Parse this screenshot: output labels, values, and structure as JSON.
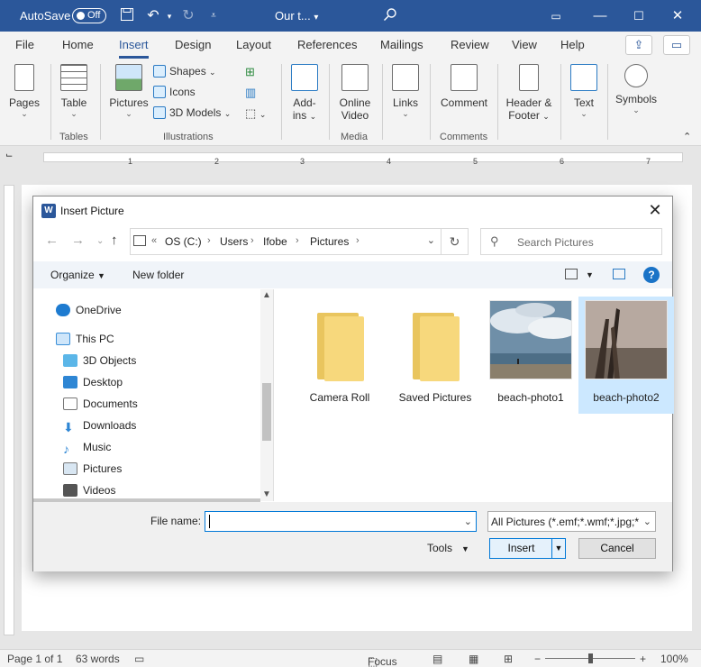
{
  "titlebar": {
    "autosave_label": "AutoSave",
    "autosave_state": "Off",
    "doc_title": "Our t...",
    "doc_title_chevron": "▾"
  },
  "menu": {
    "tabs": [
      "File",
      "Home",
      "Insert",
      "Design",
      "Layout",
      "References",
      "Mailings",
      "Review",
      "View",
      "Help"
    ],
    "active": "Insert"
  },
  "ribbon": {
    "pages": "Pages",
    "table": "Table",
    "pictures": "Pictures",
    "shapes": "Shapes",
    "icons": "Icons",
    "models_3d": "3D Models",
    "addins_1": "Add-",
    "addins_2": "ins",
    "online_video_1": "Online",
    "online_video_2": "Video",
    "links": "Links",
    "comment": "Comment",
    "header_footer_1": "Header &",
    "header_footer_2": "Footer",
    "text": "Text",
    "symbols": "Symbols",
    "groups": {
      "tables": "Tables",
      "illustrations": "Illustrations",
      "media": "Media",
      "comments": "Comments"
    }
  },
  "ruler": {
    "numbers": [
      "1",
      "2",
      "3",
      "4",
      "5",
      "6",
      "7"
    ]
  },
  "dialog": {
    "title": "Insert Picture",
    "breadcrumb": [
      "OS (C:)",
      "Users",
      "Ifobe",
      "Pictures"
    ],
    "search_placeholder": "Search Pictures",
    "organize": "Organize",
    "new_folder": "New folder",
    "nav_items": [
      "OneDrive",
      "This PC",
      "3D Objects",
      "Desktop",
      "Documents",
      "Downloads",
      "Music",
      "Pictures",
      "Videos"
    ],
    "files": [
      {
        "name": "Camera Roll",
        "kind": "folder"
      },
      {
        "name": "Saved Pictures",
        "kind": "folder"
      },
      {
        "name": "beach-photo1",
        "kind": "image"
      },
      {
        "name": "beach-photo2",
        "kind": "image",
        "selected": true
      }
    ],
    "file_name_label": "File name:",
    "file_name_value": "",
    "filter_value": "All Pictures (*.emf;*.wmf;*.jpg;*",
    "tools": "Tools",
    "insert": "Insert",
    "cancel": "Cancel"
  },
  "statusbar": {
    "page": "Page 1 of 1",
    "words": "63 words",
    "focus": "Focus",
    "zoom": "100%"
  },
  "colors": {
    "title_bar": "#2b579a",
    "accent": "#0078d7",
    "selected_tile": "#cce8ff"
  }
}
